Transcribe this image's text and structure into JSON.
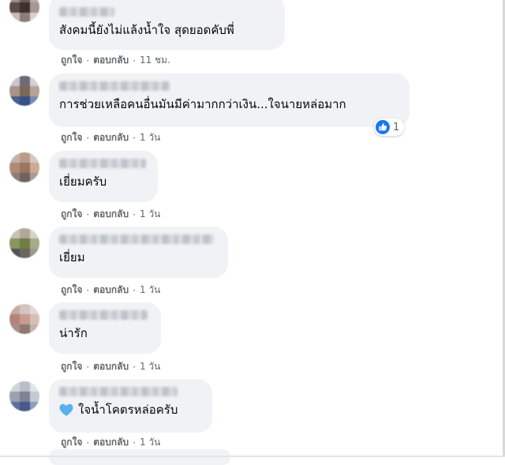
{
  "comments": [
    {
      "text": "สังคมนี้ยังไม่แล้งน้ำใจ สุดยอดคับพี่",
      "like": "ถูกใจ",
      "reply": "ตอบกลับ",
      "time": "11 ชม."
    },
    {
      "text": "การช่วยเหลือคนอื่นมันมีค่ามากกว่าเงิน...ใจนายหล่อมาก",
      "like": "ถูกใจ",
      "reply": "ตอบกลับ",
      "time": "1 วัน",
      "reaction_count": "1"
    },
    {
      "text": "เยี่ยมครับ",
      "like": "ถูกใจ",
      "reply": "ตอบกลับ",
      "time": "1 วัน"
    },
    {
      "text": "เยี่ยม",
      "like": "ถูกใจ",
      "reply": "ตอบกลับ",
      "time": "1 วัน"
    },
    {
      "text": "น่ารัก",
      "like": "ถูกใจ",
      "reply": "ตอบกลับ",
      "time": "1 วัน"
    },
    {
      "text": "ใจน้ำโคตรหล่อครับ",
      "like": "ถูกใจ",
      "reply": "ตอบกลับ",
      "time": "1 วัน",
      "emoji": "blue-heart-icon"
    }
  ],
  "separator": "·",
  "colors": {
    "bubble": "#f0f2f5",
    "meta_text": "#65676b",
    "like_blue": "#1877f2",
    "heart_blue": "#5ab0ef"
  }
}
